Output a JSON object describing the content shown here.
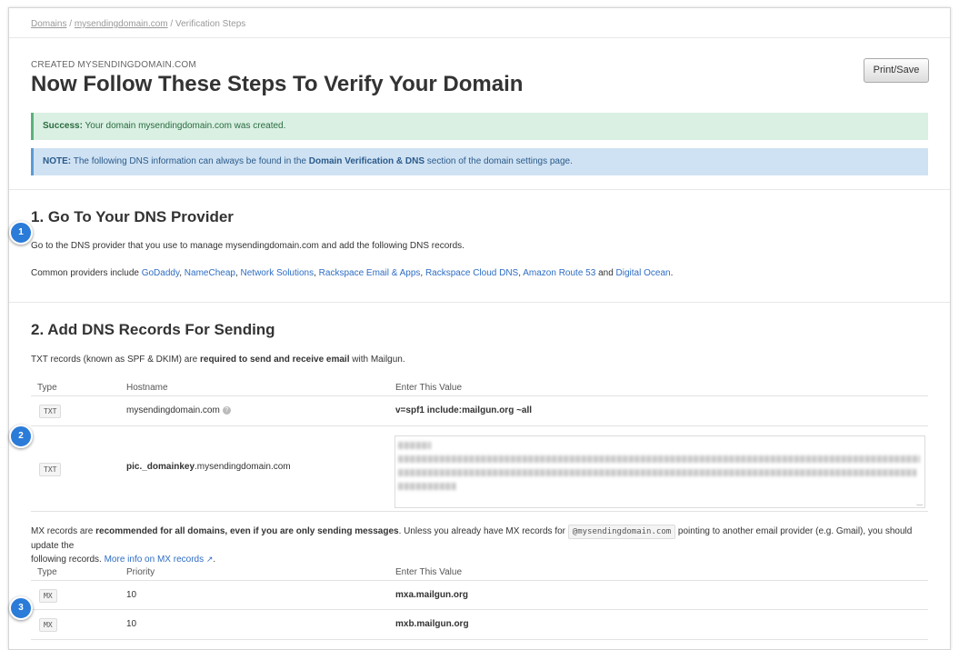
{
  "breadcrumb": {
    "domains": "Domains",
    "sep1": " / ",
    "domain": "mysendingdomain.com",
    "sep2": " / ",
    "current": "Verification Steps"
  },
  "header": {
    "subtitle": "CREATED MYSENDINGDOMAIN.COM",
    "title": "Now Follow These Steps To Verify Your Domain",
    "print_label": "Print/Save"
  },
  "alerts": {
    "success_label": "Success:",
    "success_text": " Your domain mysendingdomain.com was created.",
    "note_label": "NOTE:",
    "note_text_1": " The following DNS information can always be found in the ",
    "note_bold": "Domain Verification & DNS",
    "note_text_2": " section of the domain settings page."
  },
  "step1": {
    "heading": "1. Go To Your DNS Provider",
    "intro": "Go to the DNS provider that you use to manage mysendingdomain.com and add the following DNS records.",
    "providers_prefix": "Common providers include ",
    "providers": [
      "GoDaddy",
      "NameCheap",
      "Network Solutions",
      "Rackspace Email & Apps",
      "Rackspace Cloud DNS",
      "Amazon Route 53",
      "Digital Ocean"
    ],
    "sep_comma": ", ",
    "sep_and": " and ",
    "providers_suffix": "."
  },
  "step2": {
    "heading": "2. Add DNS Records For Sending",
    "txt_intro_1": "TXT records (known as SPF & DKIM) are ",
    "txt_intro_bold": "required to send and receive email",
    "txt_intro_2": " with Mailgun.",
    "txt_columns": [
      "Type",
      "Hostname",
      "Enter This Value"
    ],
    "txt_rows": [
      {
        "type": "TXT",
        "host": "mysendingdomain.com",
        "value": "v=spf1 include:mailgun.org ~all"
      },
      {
        "type": "TXT",
        "host_bold": "pic._domainkey",
        "host_rest": ".mysendingdomain.com",
        "value": ""
      }
    ],
    "mx_intro_1": "MX records are ",
    "mx_intro_bold": "recommended for all domains, even if you are only sending messages",
    "mx_intro_2": ". Unless you already have MX records for ",
    "mx_code": "@mysendingdomain.com",
    "mx_intro_3": " pointing to another email provider (e.g. Gmail), you should update the",
    "mx_intro_4": "following records. ",
    "mx_link": "More info on MX records",
    "mx_intro_5": ".",
    "mx_columns": [
      "Type",
      "Priority",
      "Enter This Value"
    ],
    "mx_rows": [
      {
        "type": "MX",
        "priority": "10",
        "value": "mxa.mailgun.org"
      },
      {
        "type": "MX",
        "priority": "10",
        "value": "mxb.mailgun.org"
      }
    ]
  },
  "badges": [
    "1",
    "2",
    "3"
  ]
}
